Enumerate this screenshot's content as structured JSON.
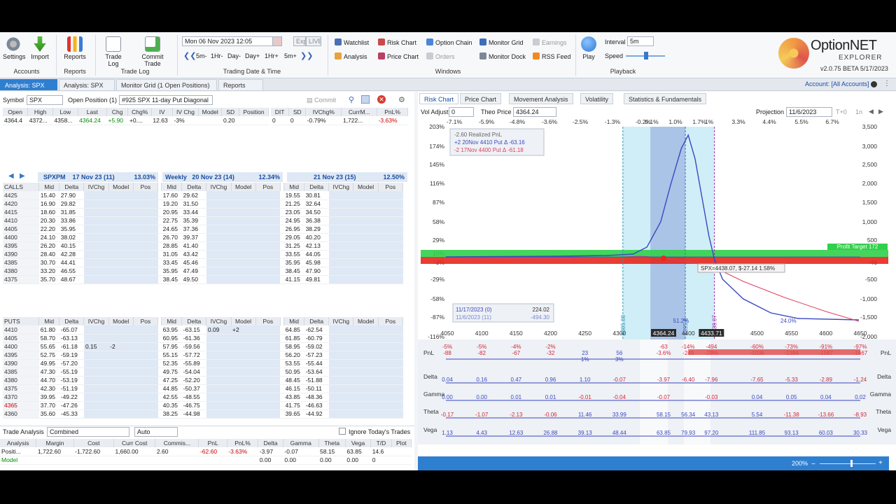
{
  "ribbon": {
    "settings": "Settings",
    "import": "Import",
    "reports": "Reports",
    "trade_log": "Trade Log",
    "commit_trade": "Commit Trade",
    "grp_accounts": "Accounts",
    "grp_reports": "Reports",
    "grp_tradelog": "Trade Log",
    "date_value": "Mon 06 Nov 2023 12:05",
    "exp": "Exp",
    "live": "LIVE",
    "steps": [
      "5m-",
      "1Hr-",
      "Day-",
      "Day+",
      "1Hr+",
      "5m+"
    ],
    "grp_datetime": "Trading Date & Time",
    "watchlist": "Watchlist",
    "analysis": "Analysis",
    "risk_chart": "Risk Chart",
    "price_chart": "Price Chart",
    "option_chain": "Option Chain",
    "orders": "Orders",
    "monitor_grid": "Monitor Grid",
    "monitor_dock": "Monitor Dock",
    "earnings": "Earnings",
    "rss_feed": "RSS Feed",
    "grp_windows": "Windows",
    "play": "Play",
    "interval_label": "Interval",
    "interval_value": "5m",
    "speed_label": "Speed",
    "grp_playback": "Playback",
    "brand_top": "OptionNET",
    "brand_bottom": "EXPLORER",
    "version": "v2.0.75 BETA 5/17/2023"
  },
  "tabs": {
    "t1": "Analysis: SPX",
    "t2": "Analysis: SPX",
    "t3": "Monitor Grid (1 Open Positions)",
    "t4": "Reports",
    "account": "Account: [All Accounts]"
  },
  "left": {
    "symbol_label": "Symbol",
    "symbol_value": "SPX",
    "open_pos_label": "Open Position (1)",
    "position_value": "#925 SPX 11-day Put Diagonal",
    "commit": "Commit",
    "quote_headers": [
      "Open",
      "High",
      "Low",
      "Last",
      "Chg",
      "Chg%",
      "IV",
      "IV Chg",
      "Model",
      "SD",
      "Position"
    ],
    "quote_values": [
      "4364.4",
      "4372...",
      "4358...",
      "4364.24",
      "+5.90",
      "+0....",
      "12.63",
      "-3%",
      "",
      "0.20",
      ""
    ],
    "dit_headers": [
      "DIT",
      "SD",
      "IVChg%",
      "CurrM...",
      "PnL%"
    ],
    "dit_values": [
      "0",
      "0",
      "-0.79%",
      "1,722...",
      "-3.63%"
    ],
    "expiries": [
      {
        "name": "SPXPM",
        "date": "17 Nov 23 (11)",
        "iv": "13.03%"
      },
      {
        "name": "Weekly",
        "date": "20 Nov 23 (14)",
        "iv": "12.34%"
      },
      {
        "name": "",
        "date": "21 Nov 23 (15)",
        "iv": "12.50%"
      }
    ],
    "col_headers": [
      "Mid",
      "Delta",
      "IVChg",
      "Model",
      "Pos"
    ],
    "calls_label": "CALLS",
    "puts_label": "PUTS",
    "calls": [
      {
        "k": "4425",
        "a": [
          "15.40",
          "27.90"
        ],
        "b": [
          "17.60",
          "29.62"
        ],
        "c": [
          "19.55",
          "30.81"
        ]
      },
      {
        "k": "4420",
        "a": [
          "16.90",
          "29.82"
        ],
        "b": [
          "19.20",
          "31.50"
        ],
        "c": [
          "21.25",
          "32.64"
        ]
      },
      {
        "k": "4415",
        "a": [
          "18.60",
          "31.85"
        ],
        "b": [
          "20.95",
          "33.44"
        ],
        "c": [
          "23.05",
          "34.50"
        ]
      },
      {
        "k": "4410",
        "a": [
          "20.30",
          "33.86"
        ],
        "b": [
          "22.75",
          "35.39"
        ],
        "c": [
          "24.95",
          "36.38"
        ]
      },
      {
        "k": "4405",
        "a": [
          "22.20",
          "35.95"
        ],
        "b": [
          "24.65",
          "37.36"
        ],
        "c": [
          "26.95",
          "38.29"
        ]
      },
      {
        "k": "4400",
        "a": [
          "24.10",
          "38.02"
        ],
        "b": [
          "26.70",
          "39.37"
        ],
        "c": [
          "29.05",
          "40.20"
        ]
      },
      {
        "k": "4395",
        "a": [
          "26.20",
          "40.15"
        ],
        "b": [
          "28.85",
          "41.40"
        ],
        "c": [
          "31.25",
          "42.13"
        ]
      },
      {
        "k": "4390",
        "a": [
          "28.40",
          "42.28"
        ],
        "b": [
          "31.05",
          "43.42"
        ],
        "c": [
          "33.55",
          "44.05"
        ]
      },
      {
        "k": "4385",
        "a": [
          "30.70",
          "44.41"
        ],
        "b": [
          "33.45",
          "45.46"
        ],
        "c": [
          "35.95",
          "45.98"
        ]
      },
      {
        "k": "4380",
        "a": [
          "33.20",
          "46.55"
        ],
        "b": [
          "35.95",
          "47.49"
        ],
        "c": [
          "38.45",
          "47.90"
        ]
      },
      {
        "k": "4375",
        "a": [
          "35.70",
          "48.67"
        ],
        "b": [
          "38.45",
          "49.50"
        ],
        "c": [
          "41.15",
          "49.81"
        ]
      }
    ],
    "puts": [
      {
        "k": "4410",
        "a": [
          "61.80",
          "-65.07",
          "",
          ""
        ],
        "b": [
          "63.95",
          "-63.15",
          "0.09",
          "+2"
        ],
        "c": [
          "64.85",
          "-62.54"
        ]
      },
      {
        "k": "4405",
        "a": [
          "58.70",
          "-63.13",
          "",
          ""
        ],
        "b": [
          "60.95",
          "-61.36",
          "",
          ""
        ],
        "c": [
          "61.85",
          "-60.79"
        ]
      },
      {
        "k": "4400",
        "a": [
          "55.65",
          "-61.18",
          "0.15",
          "-2"
        ],
        "b": [
          "57.95",
          "-59.56",
          "",
          ""
        ],
        "c": [
          "58.95",
          "-59.02"
        ]
      },
      {
        "k": "4395",
        "a": [
          "52.75",
          "-59.19",
          "",
          ""
        ],
        "b": [
          "55.15",
          "-57.72",
          "",
          ""
        ],
        "c": [
          "56.20",
          "-57.23"
        ]
      },
      {
        "k": "4390",
        "a": [
          "49.95",
          "-57.20",
          "",
          ""
        ],
        "b": [
          "52.35",
          "-55.89",
          "",
          ""
        ],
        "c": [
          "53.55",
          "-55.44"
        ]
      },
      {
        "k": "4385",
        "a": [
          "47.30",
          "-55.19",
          "",
          ""
        ],
        "b": [
          "49.75",
          "-54.04",
          "",
          ""
        ],
        "c": [
          "50.95",
          "-53.64"
        ]
      },
      {
        "k": "4380",
        "a": [
          "44.70",
          "-53.19",
          "",
          ""
        ],
        "b": [
          "47.25",
          "-52.20",
          "",
          ""
        ],
        "c": [
          "48.45",
          "-51.88"
        ]
      },
      {
        "k": "4375",
        "a": [
          "42.30",
          "-51.19",
          "",
          ""
        ],
        "b": [
          "44.85",
          "-50.37",
          "",
          ""
        ],
        "c": [
          "46.15",
          "-50.11"
        ]
      },
      {
        "k": "4370",
        "a": [
          "39.95",
          "-49.22",
          "",
          ""
        ],
        "b": [
          "42.55",
          "-48.55",
          "",
          ""
        ],
        "c": [
          "43.85",
          "-48.36"
        ]
      },
      {
        "k": "4365",
        "a": [
          "37.70",
          "-47.26",
          "",
          ""
        ],
        "b": [
          "40.35",
          "-46.75",
          "",
          ""
        ],
        "c": [
          "41.75",
          "-46.63"
        ]
      },
      {
        "k": "4360",
        "a": [
          "35.60",
          "-45.33",
          "",
          ""
        ],
        "b": [
          "38.25",
          "-44.98",
          "",
          ""
        ],
        "c": [
          "39.65",
          "-44.92"
        ]
      }
    ],
    "trade_analysis_label": "Trade Analysis",
    "combined": "Combined",
    "auto": "Auto",
    "ignore_today": "Ignore Today's Trades",
    "summary_headers": [
      "Analysis",
      "Margin",
      "Cost",
      "Curr Cost",
      "Commis...",
      "PnL",
      "PnL%",
      "Delta",
      "Gamma",
      "Theta",
      "Vega",
      "T/D",
      "Plot"
    ],
    "summary_row1": [
      "Positi...",
      "1,722.60",
      "-1,722.60",
      "1,660.00",
      "2.60",
      "-62.60",
      "-3.63%",
      "-3.97",
      "-0.07",
      "58.15",
      "63.85",
      "14.6",
      ""
    ],
    "summary_row2": [
      "Model",
      "",
      "",
      "",
      "",
      "",
      "",
      "0.00",
      "0.00",
      "0.00",
      "0.00",
      "0",
      ""
    ]
  },
  "right": {
    "tabs": [
      "Risk Chart",
      "Price Chart",
      "Movement Analysis",
      "Volatility",
      "Statistics & Fundamentals"
    ],
    "vol_adjust_label": "Vol Adjust",
    "vol_adjust_value": "0",
    "theo_label": "Theo Price",
    "theo_value": "4364.24",
    "projection_label": "Projection",
    "projection_value": "11/6/2023",
    "t_plus": "T+0",
    "zoom_btn": "1n",
    "zoom": "200%",
    "legend": {
      "realized": "-2.60 Realized PnL",
      "l1": "+2 20Nov 4410 Put Δ -63.16",
      "l2": "-2 17Nov 4400 Put Δ -61.18"
    },
    "info_box": {
      "d1": "11/17/2023 (0)",
      "v1": "224.02",
      "d2": "11/6/2023 (11)",
      "v2": "-494.30"
    },
    "tooltip": "SPX=4438.07, $-27.14 1.58%",
    "profit_target": "Profit Target 172",
    "pct_labels_top": [
      "-7.1%",
      "-5.9%",
      "-4.8%",
      "-3.6%",
      "-2.5%",
      "-1.3%",
      "-0.2%",
      "0.1%",
      "1.0%",
      "1.7%",
      "1%",
      "3.3%",
      "4.4%",
      "5.5%",
      "6.7%"
    ],
    "left_axis": [
      "203%",
      "174%",
      "145%",
      "116%",
      "87%",
      "58%",
      "29%",
      "10%",
      "-3%",
      "-29%",
      "-58%",
      "-87%",
      "-116%"
    ],
    "right_axis": [
      "3,500",
      "3,000",
      "2,500",
      "2,000",
      "1,500",
      "1,000",
      "500",
      "-46",
      "-500",
      "-1,000",
      "-1,500",
      "-2,000"
    ],
    "x_ticks": [
      "4050",
      "4100",
      "4150",
      "4200",
      "4250",
      "4300",
      "4364.24",
      "4400",
      "4433.71",
      "4500",
      "4550",
      "4600",
      "4650"
    ],
    "vlabels": [
      "4305.08",
      "4395.8",
      "4438.07"
    ],
    "pct_in_band": "51.2%",
    "pct_right": "24.0%",
    "greek_labels": [
      "PnL",
      "Delta",
      "Gamma",
      "Theta",
      "Vega"
    ],
    "greeks": {
      "pnl_top": [
        "-5%",
        "-5%",
        "-4%",
        "-2%",
        "",
        "",
        "-63",
        "-14%",
        "-494",
        "-60%",
        "-73%",
        "-91%",
        "-97%"
      ],
      "pnl_bot": [
        "-88",
        "-82",
        "-67",
        "-32",
        "23",
        "56",
        "-3.6%",
        "-249",
        "-29%",
        "-1036",
        "-1384",
        "-1587",
        "-1667"
      ],
      "pnl_mid": [
        "",
        "",
        "",
        "",
        "1%",
        "3%",
        "",
        "",
        "",
        "",
        "",
        "",
        ""
      ],
      "delta": [
        "0.04",
        "0.16",
        "0.47",
        "0.96",
        "1.10",
        "-0.07",
        "-3.97",
        "-6.40",
        "-7.96",
        "-7.65",
        "-5.33",
        "-2.89",
        "-1.24"
      ],
      "gamma": [
        "0.00",
        "0.00",
        "0.01",
        "0.01",
        "-0.01",
        "-0.04",
        "-0.07",
        "",
        "-0.03",
        "0.04",
        "0.05",
        "0.04",
        "0.02"
      ],
      "theta": [
        "-0.17",
        "-1.07",
        "-2.13",
        "-0.06",
        "11.46",
        "33.99",
        "58.15",
        "56.34",
        "43.13",
        "5.54",
        "-11.38",
        "-13.66",
        "-8.93"
      ],
      "vega": [
        "1.13",
        "4.43",
        "12.63",
        "26.88",
        "39.13",
        "48.44",
        "63.85",
        "79.93",
        "97.20",
        "111.85",
        "93.13",
        "60.03",
        "30.33"
      ]
    }
  }
}
